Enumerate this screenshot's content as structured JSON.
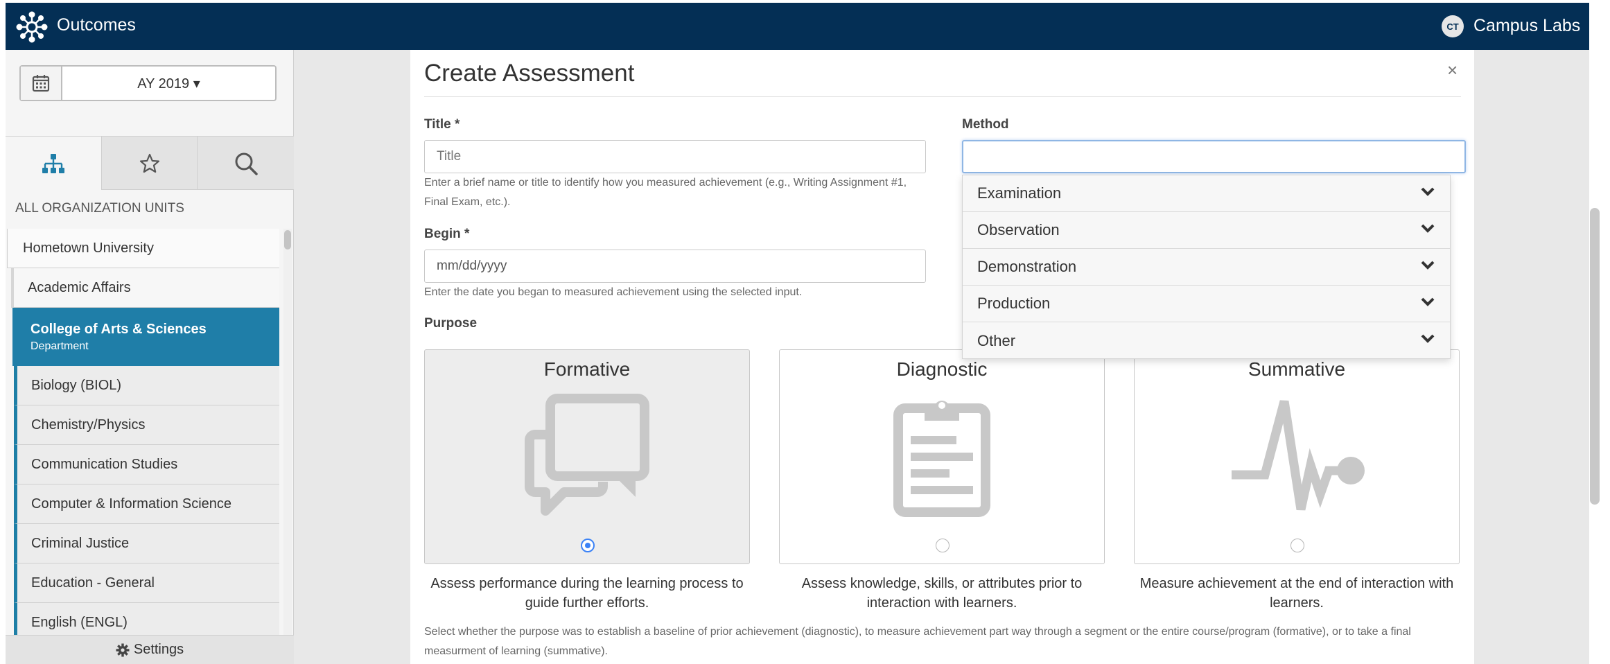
{
  "topbar": {
    "app_title": "Outcomes",
    "avatar_initials": "CT",
    "org_name": "Campus Labs",
    "background": "#042f55"
  },
  "sidebar": {
    "year_label": "AY 2019 ▾",
    "tabs": [
      "org-tree-icon",
      "star-icon",
      "search-icon"
    ],
    "units_label": "ALL ORGANIZATION UNITS",
    "tree": [
      {
        "label": "Hometown University",
        "level": 0
      },
      {
        "label": "Academic Affairs",
        "level": 1
      },
      {
        "label": "College of Arts & Sciences",
        "sublabel": "Department",
        "level": 1,
        "selected": true
      },
      {
        "label": "Biology (BIOL)",
        "level": 2
      },
      {
        "label": "Chemistry/Physics",
        "level": 2
      },
      {
        "label": "Communication Studies",
        "level": 2
      },
      {
        "label": "Computer & Information Science",
        "level": 2
      },
      {
        "label": "Criminal Justice",
        "level": 2
      },
      {
        "label": "Education - General",
        "level": 2
      },
      {
        "label": "English (ENGL)",
        "level": 2
      }
    ],
    "settings_label": "Settings",
    "selected_color": "#1f7ea8"
  },
  "modal": {
    "title": "Create Assessment",
    "close_label": "×",
    "title_field": {
      "label": "Title *",
      "placeholder": "Title",
      "help": "Enter a brief name or title to identify how you measured achievement (e.g., Writing Assignment #1, Final Exam, etc.)."
    },
    "begin_field": {
      "label": "Begin *",
      "placeholder": "mm/dd/yyyy",
      "help": "Enter the date you began to measured achievement using the selected input."
    },
    "method_field": {
      "label": "Method",
      "value": "",
      "options": [
        "Examination",
        "Observation",
        "Demonstration",
        "Production",
        "Other"
      ]
    },
    "purpose": {
      "label": "Purpose",
      "cards": [
        {
          "title": "Formative",
          "icon": "chat-bubbles-icon",
          "selected": true,
          "description": "Assess performance during the learning process to guide further efforts."
        },
        {
          "title": "Diagnostic",
          "icon": "clipboard-icon",
          "selected": false,
          "description": "Assess knowledge, skills, or attributes prior to interaction with learners."
        },
        {
          "title": "Summative",
          "icon": "pulse-icon",
          "selected": false,
          "description": "Measure achievement at the end of interaction with learners."
        }
      ],
      "help": "Select whether the purpose was to establish a baseline of prior achievement (diagnostic), to measure achievement part way through a segment or the entire course/program (formative), or to take a final measurment of learning (summative)."
    }
  }
}
